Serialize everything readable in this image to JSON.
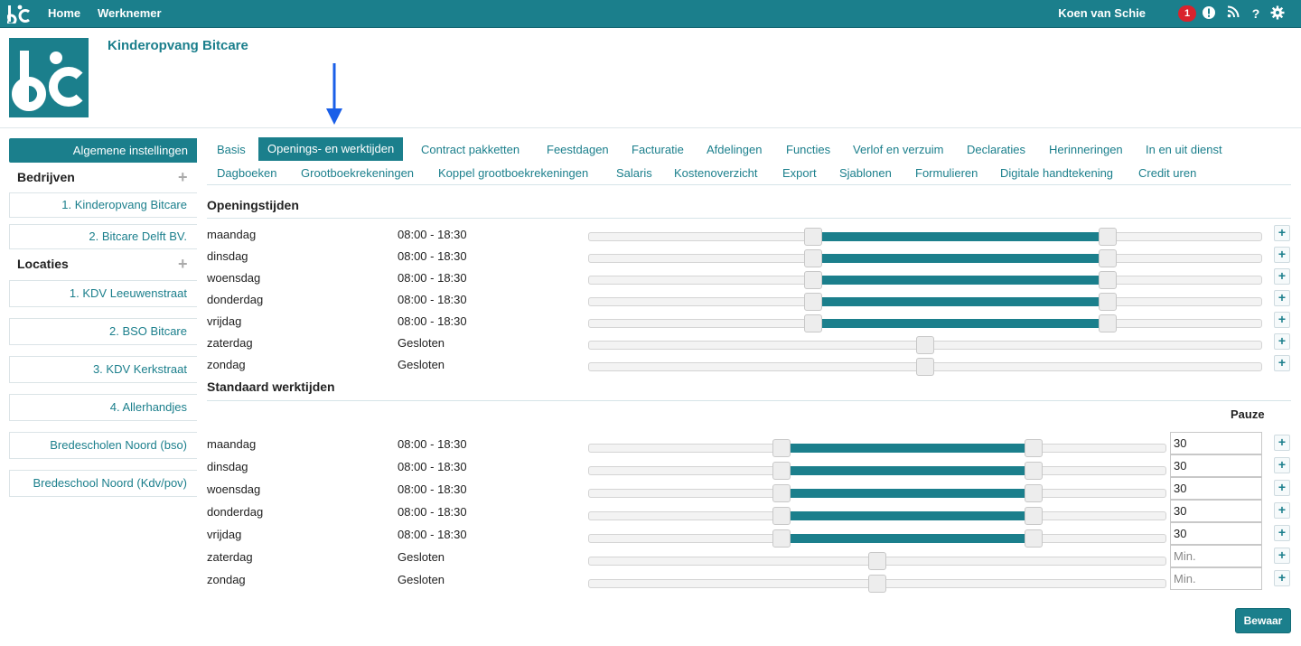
{
  "topbar": {
    "nav": [
      "Home",
      "Werknemer"
    ],
    "user": "Koen van Schie",
    "notification_count": "1",
    "icons": [
      "alert-icon",
      "rss-icon",
      "help-icon",
      "gear-icon"
    ],
    "help_glyph": "?"
  },
  "header": {
    "title": "Kinderopvang Bitcare"
  },
  "sidebar": {
    "heading": "Algemene instellingen",
    "bedrijven_label": "Bedrijven",
    "bedrijven": [
      "1. Kinderopvang Bitcare",
      "2. Bitcare Delft BV."
    ],
    "locaties_label": "Locaties",
    "locaties": [
      "1. KDV Leeuwenstraat",
      "2. BSO Bitcare",
      "3. KDV Kerkstraat",
      "4. Allerhandjes",
      "Bredescholen Noord (bso)",
      "Bredeschool Noord (Kdv/pov)"
    ]
  },
  "tabs": {
    "row1": [
      "Basis",
      "Openings- en werktijden",
      "Contract pakketten",
      "Feestdagen",
      "Facturatie",
      "Afdelingen",
      "Functies",
      "Verlof en verzuim",
      "Declaraties",
      "Herinneringen",
      "In en uit dienst"
    ],
    "row2": [
      "Dagboeken",
      "Grootboekrekeningen",
      "Koppel grootboekrekeningen",
      "Salaris",
      "Kostenoverzicht",
      "Export",
      "Sjablonen",
      "Formulieren",
      "Digitale handtekening",
      "Credit uren"
    ],
    "active": "Openings- en werktijden"
  },
  "openingstijden": {
    "title": "Openingstijden",
    "rows": [
      {
        "day": "maandag",
        "time": "08:00 - 18:30",
        "open": true
      },
      {
        "day": "dinsdag",
        "time": "08:00 - 18:30",
        "open": true
      },
      {
        "day": "woensdag",
        "time": "08:00 - 18:30",
        "open": true
      },
      {
        "day": "donderdag",
        "time": "08:00 - 18:30",
        "open": true
      },
      {
        "day": "vrijdag",
        "time": "08:00 - 18:30",
        "open": true
      },
      {
        "day": "zaterdag",
        "time": "Gesloten",
        "open": false
      },
      {
        "day": "zondag",
        "time": "Gesloten",
        "open": false
      }
    ]
  },
  "werktijden": {
    "title": "Standaard werktijden",
    "pauze_label": "Pauze",
    "pauze_placeholder": "Min.",
    "rows": [
      {
        "day": "maandag",
        "time": "08:00 - 18:30",
        "open": true,
        "pauze": "30"
      },
      {
        "day": "dinsdag",
        "time": "08:00 - 18:30",
        "open": true,
        "pauze": "30"
      },
      {
        "day": "woensdag",
        "time": "08:00 - 18:30",
        "open": true,
        "pauze": "30"
      },
      {
        "day": "donderdag",
        "time": "08:00 - 18:30",
        "open": true,
        "pauze": "30"
      },
      {
        "day": "vrijdag",
        "time": "08:00 - 18:30",
        "open": true,
        "pauze": "30"
      },
      {
        "day": "zaterdag",
        "time": "Gesloten",
        "open": false,
        "pauze": ""
      },
      {
        "day": "zondag",
        "time": "Gesloten",
        "open": false,
        "pauze": ""
      }
    ]
  },
  "save_label": "Bewaar",
  "colors": {
    "brand": "#1b7f8c",
    "badge": "#d9232d",
    "arrow": "#1a5fe8"
  }
}
